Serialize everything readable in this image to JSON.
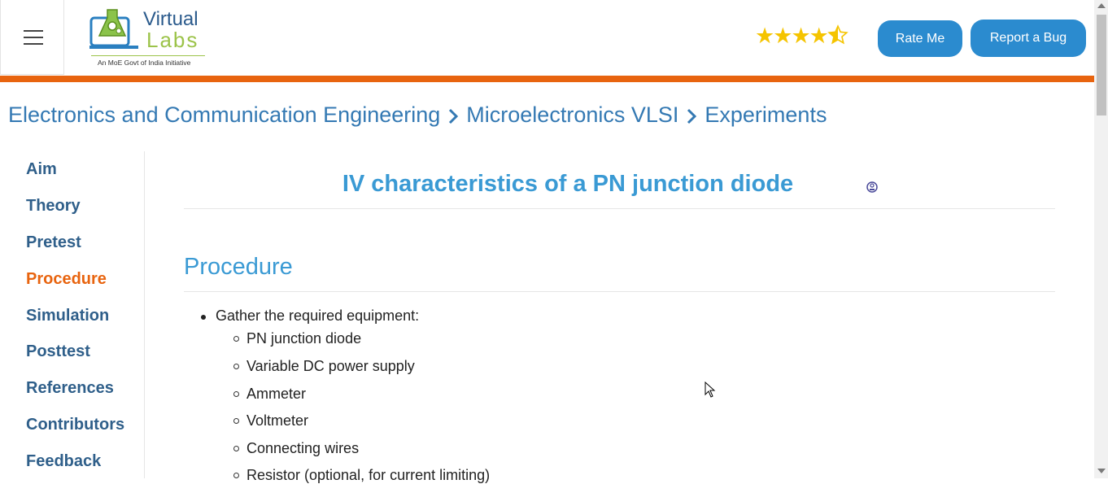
{
  "header": {
    "logo": {
      "line1": "Virtual",
      "line2": "Labs",
      "tagline": "An MoE Govt of India Initiative"
    },
    "rating": {
      "value": 4.5,
      "max": 5,
      "icon": "star-icon",
      "color": "#f5c400"
    },
    "rate_button": "Rate Me",
    "bug_button": "Report a Bug",
    "accent_color": "#e8640f",
    "button_color": "#2b8bcf"
  },
  "breadcrumb": {
    "items": [
      "Electronics and Communication Engineering",
      "Microelectronics VLSI",
      "Experiments"
    ],
    "separator_icon": "chevron-right-icon"
  },
  "sidebar": {
    "items": [
      {
        "label": "Aim",
        "active": false
      },
      {
        "label": "Theory",
        "active": false
      },
      {
        "label": "Pretest",
        "active": false
      },
      {
        "label": "Procedure",
        "active": true
      },
      {
        "label": "Simulation",
        "active": false
      },
      {
        "label": "Posttest",
        "active": false
      },
      {
        "label": "References",
        "active": false
      },
      {
        "label": "Contributors",
        "active": false
      },
      {
        "label": "Feedback",
        "active": false
      }
    ]
  },
  "main": {
    "title": "IV characteristics of a PN junction diode",
    "title_icon": "info-icon",
    "section_heading": "Procedure",
    "list": {
      "item1": "Gather the required equipment:",
      "subitems": [
        "PN junction diode",
        "Variable DC power supply",
        "Ammeter",
        "Voltmeter",
        "Connecting wires",
        "Resistor (optional, for current limiting)"
      ]
    }
  }
}
